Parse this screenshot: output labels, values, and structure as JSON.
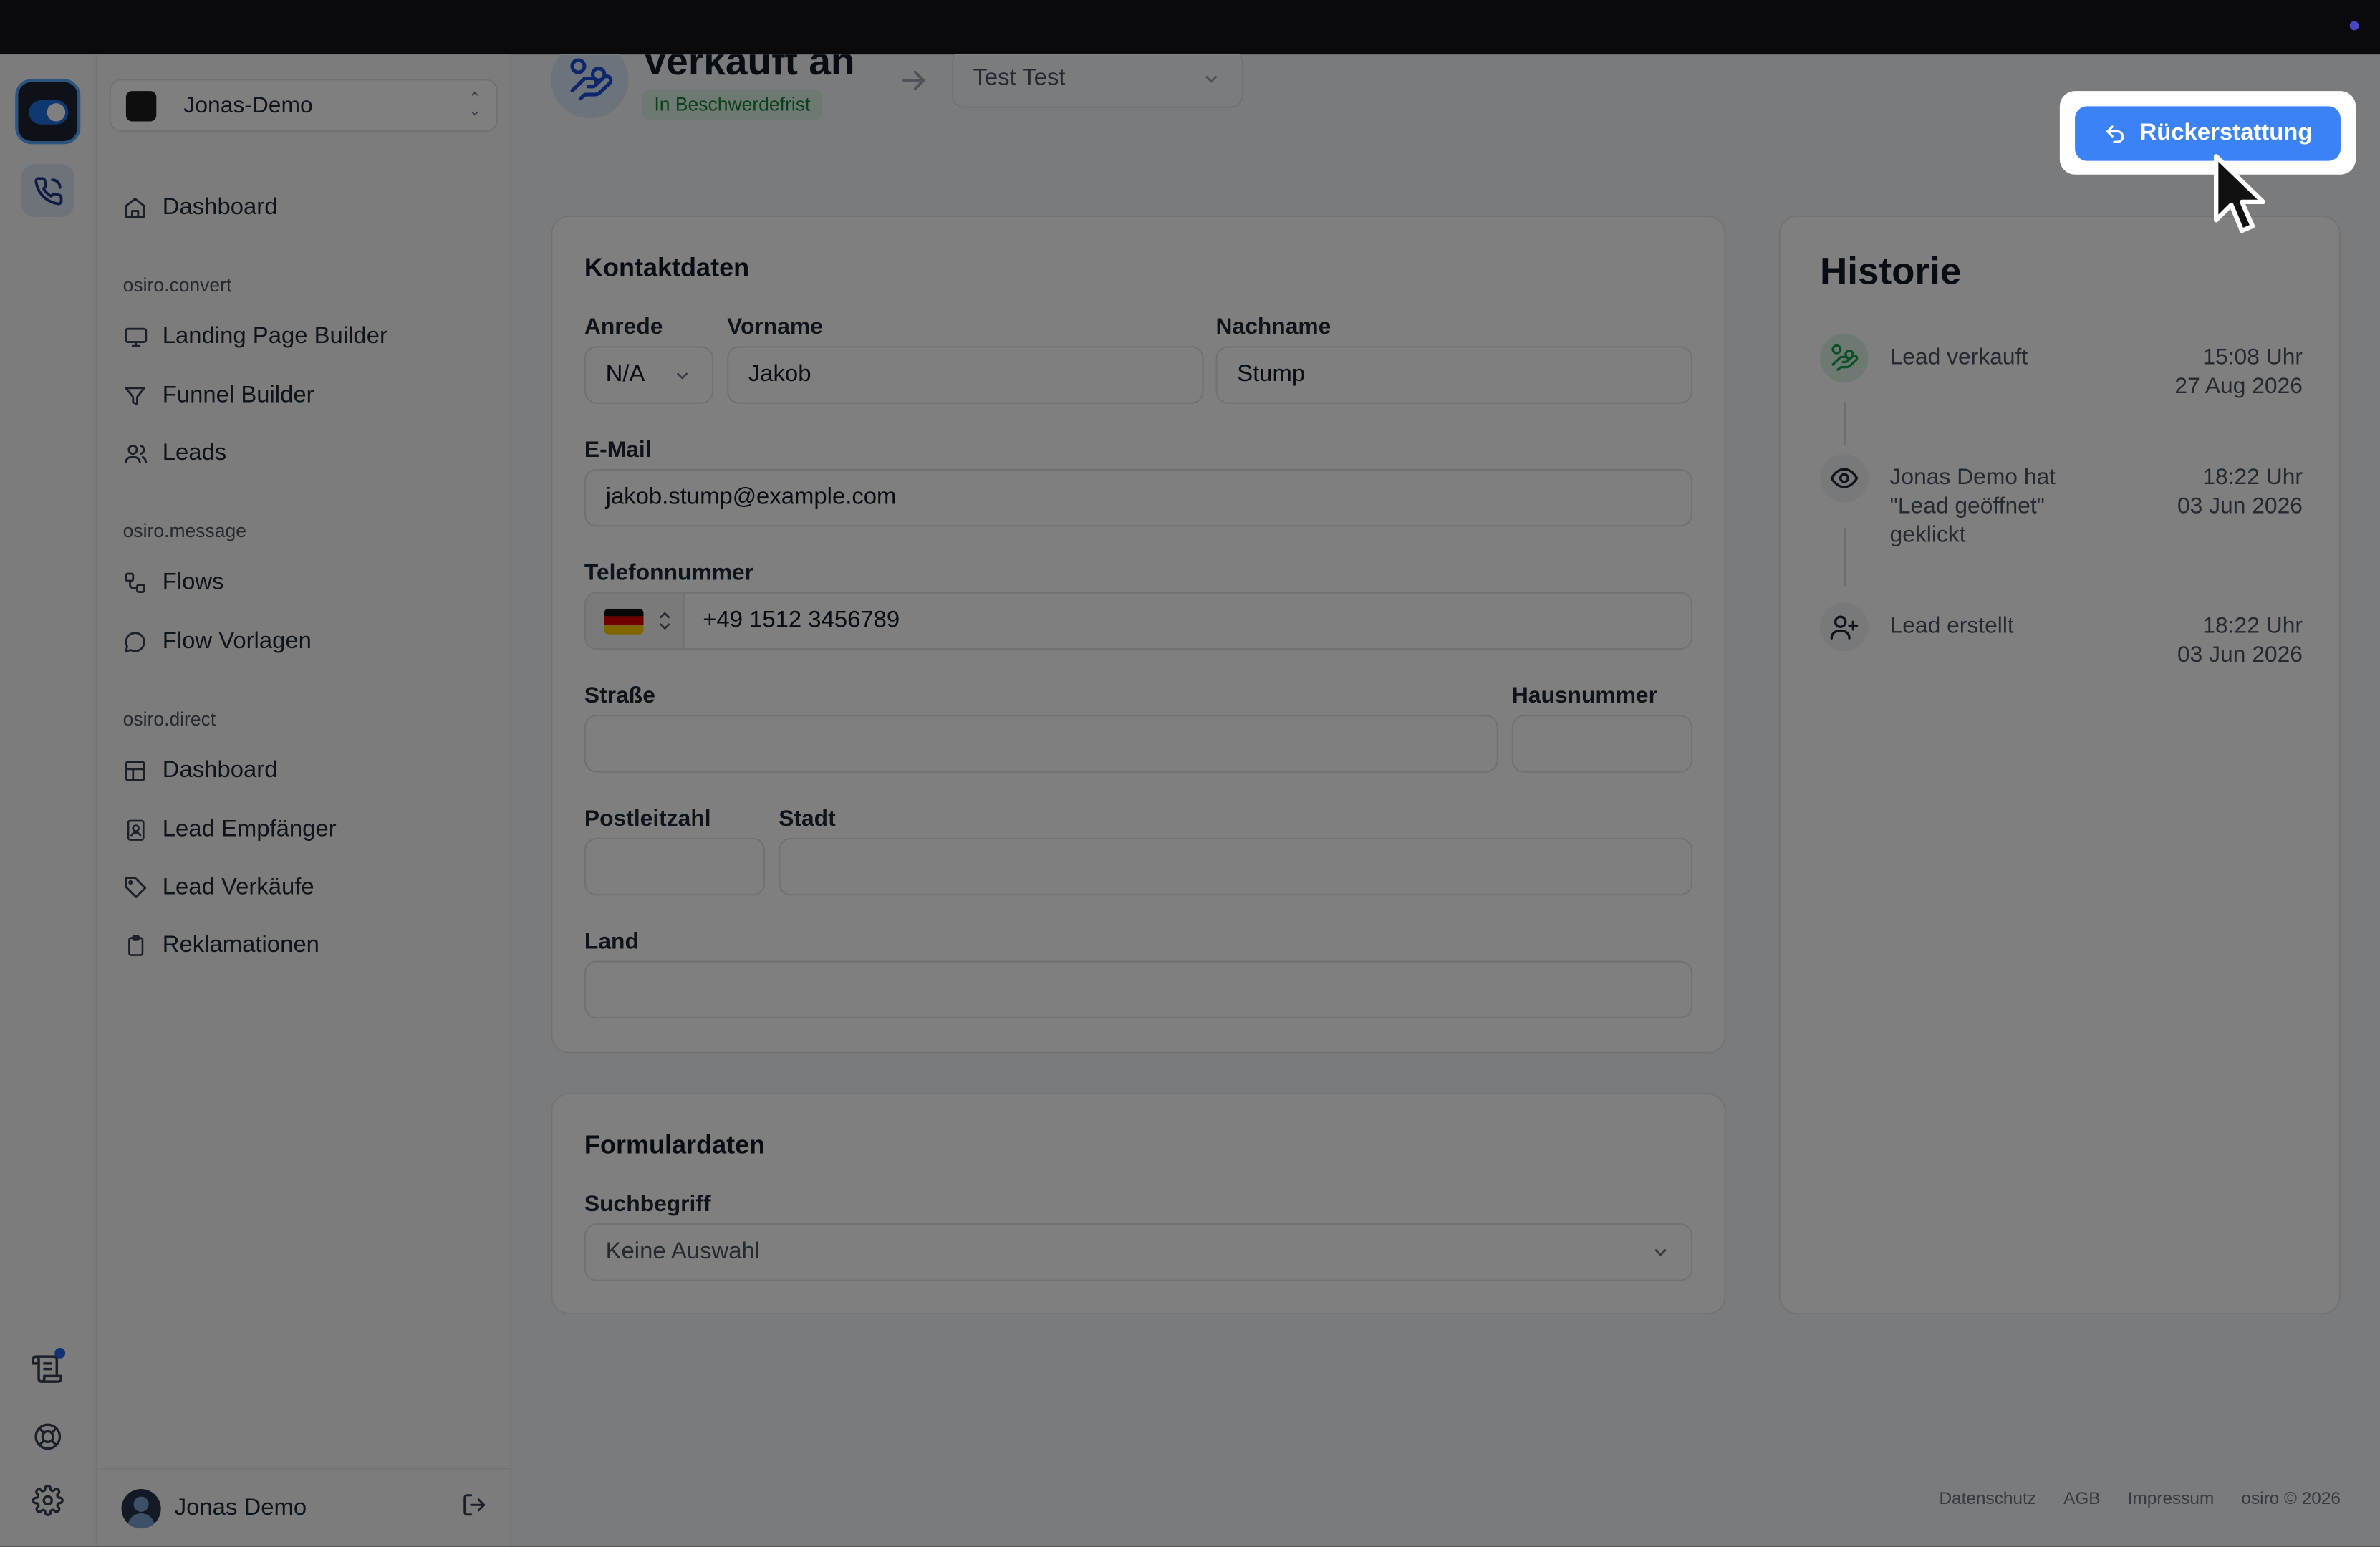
{
  "workspace": {
    "name": "Jonas-Demo"
  },
  "sidebar": {
    "top_item": "Dashboard",
    "groups": [
      {
        "section": "osiro.convert",
        "items": [
          "Landing Page Builder",
          "Funnel Builder",
          "Leads"
        ]
      },
      {
        "section": "osiro.message",
        "items": [
          "Flows",
          "Flow Vorlagen"
        ]
      },
      {
        "section": "osiro.direct",
        "items": [
          "Dashboard",
          "Lead Empfänger",
          "Lead Verkäufe",
          "Reklamationen"
        ]
      }
    ],
    "user_name": "Jonas Demo"
  },
  "header": {
    "title": "Verkauft an",
    "status_badge": "In Beschwerdefrist",
    "buyer": "Test Test",
    "refund_label": "Rückerstattung"
  },
  "contact": {
    "title": "Kontaktdaten",
    "salutation_label": "Anrede",
    "salutation_value": "N/A",
    "firstname_label": "Vorname",
    "firstname_value": "Jakob",
    "lastname_label": "Nachname",
    "lastname_value": "Stump",
    "email_label": "E-Mail",
    "email_value": "jakob.stump@example.com",
    "phone_label": "Telefonnummer",
    "phone_value": "+49 1512 3456789",
    "street_label": "Straße",
    "street_value": "",
    "houseno_label": "Hausnummer",
    "houseno_value": "",
    "zip_label": "Postleitzahl",
    "zip_value": "",
    "city_label": "Stadt",
    "city_value": "",
    "country_label": "Land",
    "country_value": ""
  },
  "form": {
    "title": "Formulardaten",
    "search_label": "Suchbegriff",
    "search_value": "Keine Auswahl"
  },
  "history": {
    "title": "Historie",
    "events": [
      {
        "text": "Lead verkauft",
        "time": "15:08 Uhr",
        "date": "27 Aug 2026",
        "icon": "hand-coins-icon"
      },
      {
        "text": "Jonas Demo hat \"Lead geöffnet\" geklickt",
        "time": "18:22 Uhr",
        "date": "03 Jun 2026",
        "icon": "eye-icon"
      },
      {
        "text": "Lead erstellt",
        "time": "18:22 Uhr",
        "date": "03 Jun 2026",
        "icon": "user-plus-icon"
      }
    ]
  },
  "footer": {
    "links": [
      "Datenschutz",
      "AGB",
      "Impressum",
      "osiro © 2026"
    ]
  },
  "colors": {
    "accent": "#3b82f6",
    "badge_green": "#15803d",
    "overlay": "rgba(0,0,0,0.5)"
  }
}
